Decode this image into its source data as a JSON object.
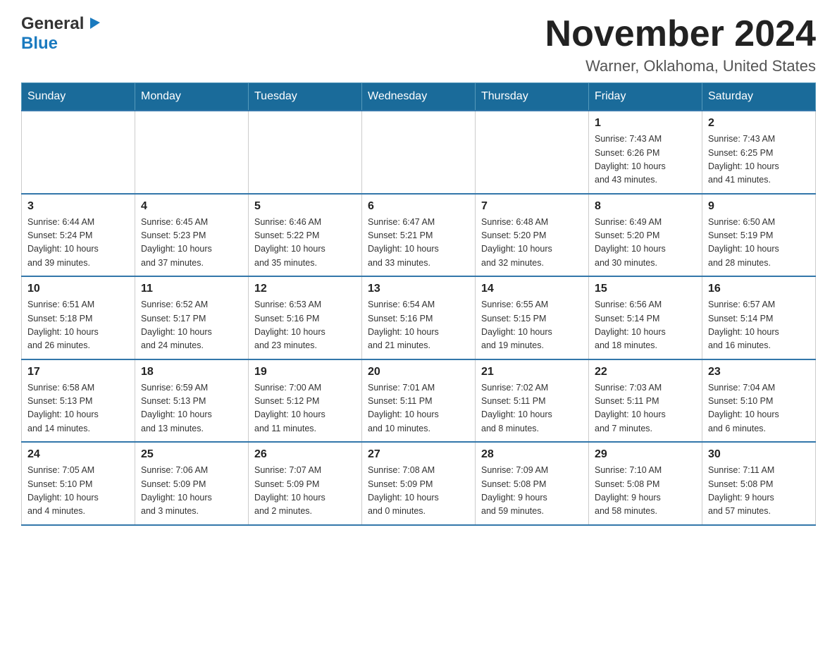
{
  "header": {
    "logo_general": "General",
    "logo_blue": "Blue",
    "month_title": "November 2024",
    "location": "Warner, Oklahoma, United States"
  },
  "weekdays": [
    "Sunday",
    "Monday",
    "Tuesday",
    "Wednesday",
    "Thursday",
    "Friday",
    "Saturday"
  ],
  "weeks": [
    [
      {
        "day": "",
        "info": ""
      },
      {
        "day": "",
        "info": ""
      },
      {
        "day": "",
        "info": ""
      },
      {
        "day": "",
        "info": ""
      },
      {
        "day": "",
        "info": ""
      },
      {
        "day": "1",
        "info": "Sunrise: 7:43 AM\nSunset: 6:26 PM\nDaylight: 10 hours\nand 43 minutes."
      },
      {
        "day": "2",
        "info": "Sunrise: 7:43 AM\nSunset: 6:25 PM\nDaylight: 10 hours\nand 41 minutes."
      }
    ],
    [
      {
        "day": "3",
        "info": "Sunrise: 6:44 AM\nSunset: 5:24 PM\nDaylight: 10 hours\nand 39 minutes."
      },
      {
        "day": "4",
        "info": "Sunrise: 6:45 AM\nSunset: 5:23 PM\nDaylight: 10 hours\nand 37 minutes."
      },
      {
        "day": "5",
        "info": "Sunrise: 6:46 AM\nSunset: 5:22 PM\nDaylight: 10 hours\nand 35 minutes."
      },
      {
        "day": "6",
        "info": "Sunrise: 6:47 AM\nSunset: 5:21 PM\nDaylight: 10 hours\nand 33 minutes."
      },
      {
        "day": "7",
        "info": "Sunrise: 6:48 AM\nSunset: 5:20 PM\nDaylight: 10 hours\nand 32 minutes."
      },
      {
        "day": "8",
        "info": "Sunrise: 6:49 AM\nSunset: 5:20 PM\nDaylight: 10 hours\nand 30 minutes."
      },
      {
        "day": "9",
        "info": "Sunrise: 6:50 AM\nSunset: 5:19 PM\nDaylight: 10 hours\nand 28 minutes."
      }
    ],
    [
      {
        "day": "10",
        "info": "Sunrise: 6:51 AM\nSunset: 5:18 PM\nDaylight: 10 hours\nand 26 minutes."
      },
      {
        "day": "11",
        "info": "Sunrise: 6:52 AM\nSunset: 5:17 PM\nDaylight: 10 hours\nand 24 minutes."
      },
      {
        "day": "12",
        "info": "Sunrise: 6:53 AM\nSunset: 5:16 PM\nDaylight: 10 hours\nand 23 minutes."
      },
      {
        "day": "13",
        "info": "Sunrise: 6:54 AM\nSunset: 5:16 PM\nDaylight: 10 hours\nand 21 minutes."
      },
      {
        "day": "14",
        "info": "Sunrise: 6:55 AM\nSunset: 5:15 PM\nDaylight: 10 hours\nand 19 minutes."
      },
      {
        "day": "15",
        "info": "Sunrise: 6:56 AM\nSunset: 5:14 PM\nDaylight: 10 hours\nand 18 minutes."
      },
      {
        "day": "16",
        "info": "Sunrise: 6:57 AM\nSunset: 5:14 PM\nDaylight: 10 hours\nand 16 minutes."
      }
    ],
    [
      {
        "day": "17",
        "info": "Sunrise: 6:58 AM\nSunset: 5:13 PM\nDaylight: 10 hours\nand 14 minutes."
      },
      {
        "day": "18",
        "info": "Sunrise: 6:59 AM\nSunset: 5:13 PM\nDaylight: 10 hours\nand 13 minutes."
      },
      {
        "day": "19",
        "info": "Sunrise: 7:00 AM\nSunset: 5:12 PM\nDaylight: 10 hours\nand 11 minutes."
      },
      {
        "day": "20",
        "info": "Sunrise: 7:01 AM\nSunset: 5:11 PM\nDaylight: 10 hours\nand 10 minutes."
      },
      {
        "day": "21",
        "info": "Sunrise: 7:02 AM\nSunset: 5:11 PM\nDaylight: 10 hours\nand 8 minutes."
      },
      {
        "day": "22",
        "info": "Sunrise: 7:03 AM\nSunset: 5:11 PM\nDaylight: 10 hours\nand 7 minutes."
      },
      {
        "day": "23",
        "info": "Sunrise: 7:04 AM\nSunset: 5:10 PM\nDaylight: 10 hours\nand 6 minutes."
      }
    ],
    [
      {
        "day": "24",
        "info": "Sunrise: 7:05 AM\nSunset: 5:10 PM\nDaylight: 10 hours\nand 4 minutes."
      },
      {
        "day": "25",
        "info": "Sunrise: 7:06 AM\nSunset: 5:09 PM\nDaylight: 10 hours\nand 3 minutes."
      },
      {
        "day": "26",
        "info": "Sunrise: 7:07 AM\nSunset: 5:09 PM\nDaylight: 10 hours\nand 2 minutes."
      },
      {
        "day": "27",
        "info": "Sunrise: 7:08 AM\nSunset: 5:09 PM\nDaylight: 10 hours\nand 0 minutes."
      },
      {
        "day": "28",
        "info": "Sunrise: 7:09 AM\nSunset: 5:08 PM\nDaylight: 9 hours\nand 59 minutes."
      },
      {
        "day": "29",
        "info": "Sunrise: 7:10 AM\nSunset: 5:08 PM\nDaylight: 9 hours\nand 58 minutes."
      },
      {
        "day": "30",
        "info": "Sunrise: 7:11 AM\nSunset: 5:08 PM\nDaylight: 9 hours\nand 57 minutes."
      }
    ]
  ]
}
